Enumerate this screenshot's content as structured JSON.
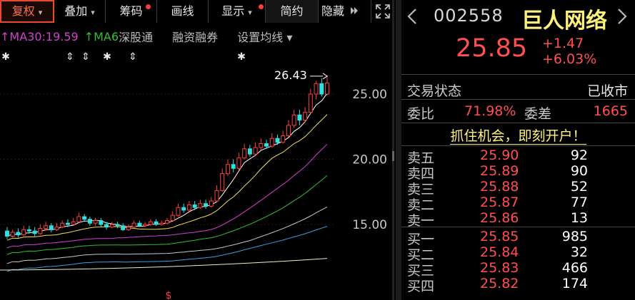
{
  "toolbar": {
    "items": [
      {
        "label": "复权",
        "caret": "▾",
        "active": true,
        "dot": false
      },
      {
        "label": "叠加",
        "caret": "▾",
        "active": false,
        "dot": false
      },
      {
        "label": "筹码",
        "caret": "",
        "active": false,
        "dot": true
      },
      {
        "label": "画线",
        "caret": "",
        "active": false,
        "dot": false
      },
      {
        "label": "显示",
        "caret": "▾",
        "active": false,
        "dot": true
      },
      {
        "label": "简约",
        "caret": "",
        "active": false,
        "dot": false
      },
      {
        "label": "隐藏",
        "caret": "",
        "active": false,
        "dot": false
      }
    ],
    "more_icon": "double-chevron-right-icon",
    "fullscreen_icon": "fullscreen-icon"
  },
  "ma_legend": {
    "ma30": {
      "arrow": "↑",
      "text": "MA30:19.59",
      "color": "#d040d0"
    },
    "ma60": {
      "arrow": "↑",
      "text": "MA6",
      "color": "#30c030"
    },
    "links": [
      "深股通",
      "融资融券",
      "设置均线 ▾"
    ]
  },
  "chart": {
    "price_labels": [
      "25.00",
      "20.00",
      "15.00"
    ],
    "high_marker": "26.43",
    "marker_glyphs": [
      "✱",
      "⇕",
      "⇕",
      "✱",
      "⇕",
      "✱"
    ],
    "up_color": "#ff4040",
    "down_color": "#30e0e0",
    "bottom_marker": "$"
  },
  "chart_data": {
    "type": "candlestick",
    "y_ticks": [
      25.0,
      20.0,
      15.0
    ],
    "max_marked": 26.43,
    "ma_series": [
      {
        "name": "MA30",
        "color": "#d040d0",
        "last": 19.59
      }
    ],
    "candles_approx": [
      [
        14.5,
        14.1,
        14.8,
        13.9
      ],
      [
        14.1,
        14.4,
        14.6,
        14.0
      ],
      [
        14.4,
        14.2,
        14.7,
        14.0
      ],
      [
        14.2,
        14.6,
        14.9,
        14.1
      ],
      [
        14.6,
        14.5,
        14.9,
        14.3
      ],
      [
        14.5,
        14.3,
        14.8,
        14.1
      ],
      [
        14.3,
        14.7,
        15.0,
        14.2
      ],
      [
        14.7,
        14.9,
        15.2,
        14.5
      ],
      [
        14.9,
        14.6,
        15.1,
        14.4
      ],
      [
        14.6,
        14.8,
        15.1,
        14.5
      ],
      [
        14.8,
        15.1,
        15.3,
        14.7
      ],
      [
        15.1,
        15.0,
        15.4,
        14.8
      ],
      [
        15.0,
        15.2,
        15.5,
        14.9
      ],
      [
        15.2,
        15.6,
        15.9,
        15.1
      ],
      [
        15.6,
        15.4,
        15.8,
        15.2
      ],
      [
        15.4,
        15.1,
        15.6,
        14.9
      ],
      [
        15.1,
        15.3,
        15.5,
        14.9
      ],
      [
        15.3,
        15.0,
        15.5,
        14.8
      ],
      [
        15.0,
        14.8,
        15.2,
        14.6
      ],
      [
        14.8,
        15.0,
        15.2,
        14.7
      ],
      [
        15.0,
        14.9,
        15.2,
        14.7
      ],
      [
        14.9,
        14.6,
        15.1,
        14.5
      ],
      [
        14.6,
        14.8,
        15.0,
        14.5
      ],
      [
        14.8,
        15.1,
        15.3,
        14.7
      ],
      [
        15.1,
        14.9,
        15.3,
        14.8
      ],
      [
        14.9,
        15.0,
        15.2,
        14.8
      ],
      [
        15.0,
        15.2,
        15.4,
        14.9
      ],
      [
        15.2,
        15.0,
        15.4,
        14.9
      ],
      [
        15.0,
        15.1,
        15.3,
        14.9
      ],
      [
        15.1,
        15.3,
        15.5,
        15.0
      ],
      [
        15.3,
        15.7,
        16.0,
        15.2
      ],
      [
        15.7,
        16.3,
        16.6,
        15.6
      ],
      [
        16.3,
        16.1,
        16.6,
        15.9
      ],
      [
        16.1,
        16.5,
        16.8,
        16.0
      ],
      [
        16.5,
        16.3,
        16.8,
        16.1
      ],
      [
        16.3,
        16.6,
        16.9,
        16.2
      ],
      [
        16.6,
        16.4,
        16.9,
        16.2
      ],
      [
        16.4,
        16.8,
        17.1,
        16.3
      ],
      [
        16.8,
        17.6,
        18.0,
        16.7
      ],
      [
        17.6,
        18.9,
        19.3,
        17.5
      ],
      [
        18.9,
        19.6,
        20.0,
        18.7
      ],
      [
        19.6,
        19.3,
        20.0,
        19.0
      ],
      [
        19.3,
        20.1,
        20.5,
        19.2
      ],
      [
        20.1,
        20.8,
        21.2,
        20.0
      ],
      [
        20.8,
        20.4,
        21.1,
        20.2
      ],
      [
        20.4,
        20.9,
        21.3,
        20.3
      ],
      [
        20.9,
        21.2,
        21.6,
        20.7
      ],
      [
        21.2,
        21.0,
        21.5,
        20.8
      ],
      [
        21.0,
        21.6,
        22.0,
        20.9
      ],
      [
        21.6,
        21.3,
        21.9,
        21.1
      ],
      [
        21.3,
        21.8,
        22.2,
        21.2
      ],
      [
        21.8,
        22.6,
        23.0,
        21.7
      ],
      [
        22.6,
        23.4,
        23.8,
        22.4
      ],
      [
        23.4,
        23.0,
        23.8,
        22.6
      ],
      [
        23.0,
        23.6,
        24.0,
        22.8
      ],
      [
        23.6,
        25.0,
        25.4,
        23.5
      ],
      [
        25.0,
        25.8,
        26.0,
        24.6
      ],
      [
        25.8,
        25.0,
        26.2,
        24.8
      ],
      [
        25.0,
        25.85,
        26.43,
        24.9
      ]
    ]
  },
  "quote": {
    "code": "002558",
    "name": "巨人网络",
    "price": "25.85",
    "change": "+1.47",
    "change_pct": "+6.03%"
  },
  "status": {
    "label": "交易状态",
    "value": "已收市"
  },
  "ratio": {
    "label1": "委比",
    "value1": "71.98%",
    "label2": "委差",
    "value2": "1665"
  },
  "cta": "抓住机会，即刻开户！",
  "order_book": [
    {
      "name": "卖五",
      "price": "25.90",
      "vol": "92"
    },
    {
      "name": "卖四",
      "price": "25.89",
      "vol": "90"
    },
    {
      "name": "卖三",
      "price": "25.88",
      "vol": "52"
    },
    {
      "name": "卖二",
      "price": "25.87",
      "vol": "77"
    },
    {
      "name": "卖一",
      "price": "25.86",
      "vol": "13"
    },
    {
      "name": "买一",
      "price": "25.85",
      "vol": "985"
    },
    {
      "name": "买二",
      "price": "25.84",
      "vol": "32"
    },
    {
      "name": "买三",
      "price": "25.83",
      "vol": "466"
    },
    {
      "name": "买四",
      "price": "25.82",
      "vol": "174"
    }
  ]
}
